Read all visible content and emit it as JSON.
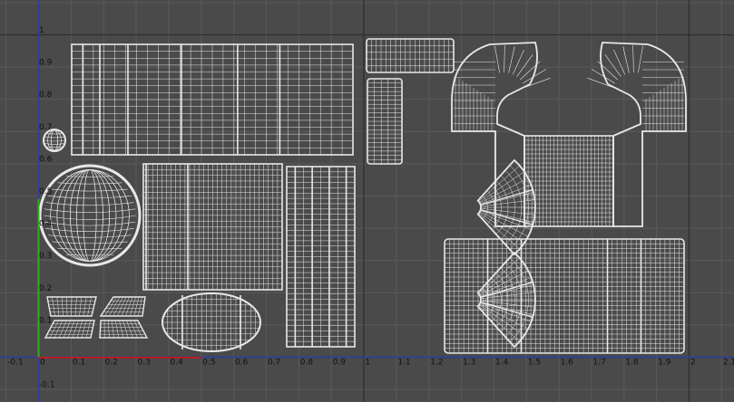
{
  "viewport": {
    "name": "UV Texture Editor",
    "colors": {
      "background": "#4a4a4a",
      "grid_minor": "#5a5a5a",
      "grid_major": "#2e2e2e",
      "wire": "#e8e8e8",
      "u_axis": "#2d3fa3",
      "v_axis": "#2a9a2a",
      "u_highlight": "#b81e1e",
      "v_highlight": "#2ab02a",
      "label": "#111111"
    }
  },
  "axes": {
    "u_ticks": [
      "-0.1",
      "0",
      "0.1",
      "0.2",
      "0.3",
      "0.4",
      "0.5",
      "0.6",
      "0.7",
      "0.8",
      "0.9",
      "1",
      "1.1",
      "1.2",
      "1.3",
      "1.4",
      "1.5",
      "1.6",
      "1.7",
      "1.8",
      "1.9",
      "2",
      "2.1"
    ],
    "v_ticks": [
      "1",
      "0.9",
      "0.8",
      "0.7",
      "0.6",
      "0.5",
      "0.4",
      "0.3",
      "0.2",
      "0.1",
      "-0.1"
    ]
  },
  "uv_shells": [
    "large-grid-shell",
    "sphere-shell",
    "small-sphere-shell",
    "mid-grid-shell",
    "vertical-strip-shell",
    "trapezoid-shells",
    "ring-shell",
    "top-rect-shell",
    "tall-rect-shell",
    "fan-shell-upper",
    "fan-shell-lower",
    "arch-shell",
    "box-shell-upper",
    "box-shell-lower"
  ]
}
